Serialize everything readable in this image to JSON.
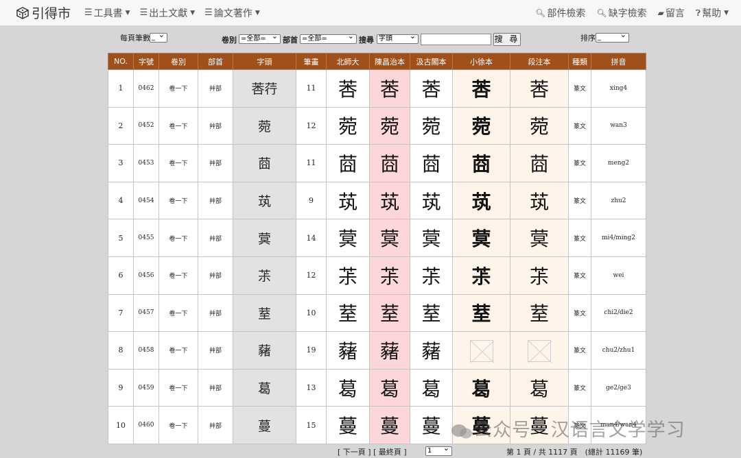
{
  "brand": {
    "name": "引得市",
    "icon": "cube-logo-icon"
  },
  "menu": [
    {
      "label": "工具書",
      "icon": "hamburger-icon"
    },
    {
      "label": "出土文獻",
      "icon": "hamburger-icon"
    },
    {
      "label": "論文著作",
      "icon": "hamburger-icon"
    }
  ],
  "nav_right": [
    {
      "label": "部件檢索",
      "icon": "search-icon"
    },
    {
      "label": "缺字檢索",
      "icon": "search-icon"
    },
    {
      "label": "留言",
      "icon": "comment-icon"
    },
    {
      "label": "幫助",
      "icon": "question-icon"
    }
  ],
  "controls": {
    "per_page_label": "每頁筆數",
    "per_page_value": "_",
    "juan_label": "卷別",
    "juan_value": "=全部=",
    "bu_label": "部首",
    "bu_value": "=全部=",
    "search_label": "搜尋",
    "search_field": "字頭",
    "search_input": "",
    "search_button": "搜 尋",
    "sort_label": "排序",
    "sort_value": "_"
  },
  "table": {
    "headers": [
      "NO.",
      "字號",
      "卷別",
      "部首",
      "字頭",
      "筆畫",
      "北師大",
      "陳昌治本",
      "汲古閣本",
      "小徐本",
      "段注本",
      "種類",
      "拼音"
    ],
    "rows": [
      {
        "no": "1",
        "id": "0462",
        "juan": "卷一下",
        "bu": "艸部",
        "head": "莕荇",
        "strokes": "11",
        "seal": "莕",
        "missing": [],
        "kind": "篆文",
        "pinyin": "xing4"
      },
      {
        "no": "2",
        "id": "0452",
        "juan": "卷一下",
        "bu": "艸部",
        "head": "菀",
        "strokes": "12",
        "seal": "菀",
        "missing": [],
        "kind": "篆文",
        "pinyin": "wan3"
      },
      {
        "no": "3",
        "id": "0453",
        "juan": "卷一下",
        "bu": "艸部",
        "head": "莔",
        "strokes": "11",
        "seal": "莔",
        "missing": [],
        "kind": "篆文",
        "pinyin": "meng2"
      },
      {
        "no": "4",
        "id": "0454",
        "juan": "卷一下",
        "bu": "艸部",
        "head": "茿",
        "strokes": "9",
        "seal": "茿",
        "missing": [],
        "kind": "篆文",
        "pinyin": "zhu2"
      },
      {
        "no": "5",
        "id": "0455",
        "juan": "卷一下",
        "bu": "艸部",
        "head": "蓂",
        "strokes": "14",
        "seal": "蓂",
        "missing": [],
        "kind": "篆文",
        "pinyin": "mi4/ming2"
      },
      {
        "no": "6",
        "id": "0456",
        "juan": "卷一下",
        "bu": "艸部",
        "head": "茮",
        "strokes": "12",
        "seal": "茮",
        "missing": [],
        "kind": "篆文",
        "pinyin": "wei"
      },
      {
        "no": "7",
        "id": "0457",
        "juan": "卷一下",
        "bu": "艸部",
        "head": "荎",
        "strokes": "10",
        "seal": "荎",
        "missing": [],
        "kind": "篆文",
        "pinyin": "chi2/die2"
      },
      {
        "no": "8",
        "id": "0458",
        "juan": "卷一下",
        "bu": "艸部",
        "head": "藸",
        "strokes": "19",
        "seal": "藸",
        "missing": [
          3,
          4
        ],
        "kind": "篆文",
        "pinyin": "chu2/zhu1"
      },
      {
        "no": "9",
        "id": "0459",
        "juan": "卷一下",
        "bu": "艸部",
        "head": "葛",
        "strokes": "13",
        "seal": "葛",
        "missing": [],
        "kind": "篆文",
        "pinyin": "ge2/ge3"
      },
      {
        "no": "10",
        "id": "0460",
        "juan": "卷一下",
        "bu": "艸部",
        "head": "蔓",
        "strokes": "15",
        "seal": "蔓",
        "missing": [],
        "kind": "篆文",
        "pinyin": "man4/wan4"
      }
    ]
  },
  "footer": {
    "nav_text": "[ 下一頁 ] [ 最終頁 ]",
    "page_select": "1",
    "summary": "第 1 頁 / 共 1117 頁　(總計 11169 筆)"
  },
  "watermark": "公众号 · 汉语言文学学习"
}
